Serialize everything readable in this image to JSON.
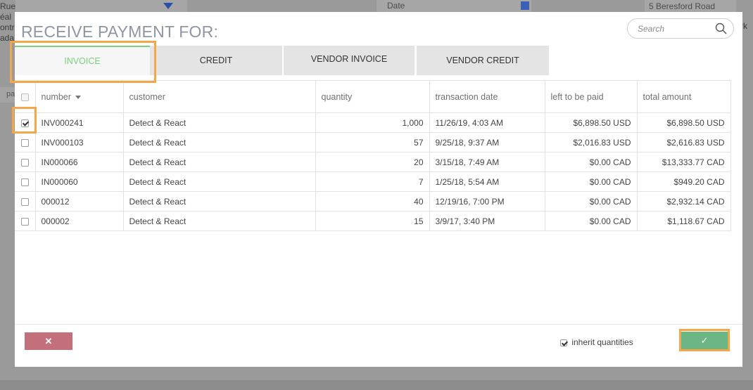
{
  "background": {
    "left_lines": [
      "Rue Deal",
      "éal",
      "ontr",
      "ada"
    ],
    "date_label": "Date",
    "top_right_text": "5 Beresford Road",
    "right_edge_text": "rk",
    "pa_text": "pa"
  },
  "modal": {
    "title": "RECEIVE PAYMENT FOR:",
    "search_placeholder": "Search",
    "tabs": [
      {
        "label": "INVOICE",
        "active": true
      },
      {
        "label": "CREDIT",
        "active": false
      },
      {
        "label": "VENDOR INVOICE",
        "active": false
      },
      {
        "label": "VENDOR CREDIT",
        "active": false
      }
    ],
    "columns": {
      "number": "number",
      "customer": "customer",
      "quantity": "quantity",
      "transaction_date": "transaction date",
      "left_to_be_paid": "left to be paid",
      "total_amount": "total amount"
    },
    "rows": [
      {
        "checked": true,
        "number": "INV000241",
        "customer": "Detect & React",
        "quantity": "1,000",
        "transaction_date": "11/26/19, 4:03 AM",
        "left_to_be_paid": "$6,898.50 USD",
        "total_amount": "$6,898.50 USD"
      },
      {
        "checked": false,
        "number": "INV000103",
        "customer": "Detect & React",
        "quantity": "57",
        "transaction_date": "9/25/18, 9:37 AM",
        "left_to_be_paid": "$2,016.83 USD",
        "total_amount": "$2,616.83 USD"
      },
      {
        "checked": false,
        "number": "IN000066",
        "customer": "Detect & React",
        "quantity": "20",
        "transaction_date": "3/15/18, 7:49 AM",
        "left_to_be_paid": "$0.00 CAD",
        "total_amount": "$13,333.77 CAD"
      },
      {
        "checked": false,
        "number": "IN000060",
        "customer": "Detect & React",
        "quantity": "7",
        "transaction_date": "1/25/18, 5:54 AM",
        "left_to_be_paid": "$0.00 CAD",
        "total_amount": "$949.20 CAD"
      },
      {
        "checked": false,
        "number": "000012",
        "customer": "Detect & React",
        "quantity": "40",
        "transaction_date": "12/19/16, 7:00 PM",
        "left_to_be_paid": "$0.00 CAD",
        "total_amount": "$2,932.14 CAD"
      },
      {
        "checked": false,
        "number": "000002",
        "customer": "Detect & React",
        "quantity": "15",
        "transaction_date": "3/9/17, 3:40 PM",
        "left_to_be_paid": "$0.00 CAD",
        "total_amount": "$1,118.67 CAD"
      }
    ],
    "footer": {
      "cancel_label": "✕",
      "inherit_label": "inherit quantities",
      "inherit_checked": true,
      "ok_label": "✓"
    }
  },
  "colors": {
    "accent_green": "#7ad17a",
    "cancel_red": "#c4707c",
    "ok_green": "#6cb585",
    "highlight_orange": "#f5a64b"
  }
}
